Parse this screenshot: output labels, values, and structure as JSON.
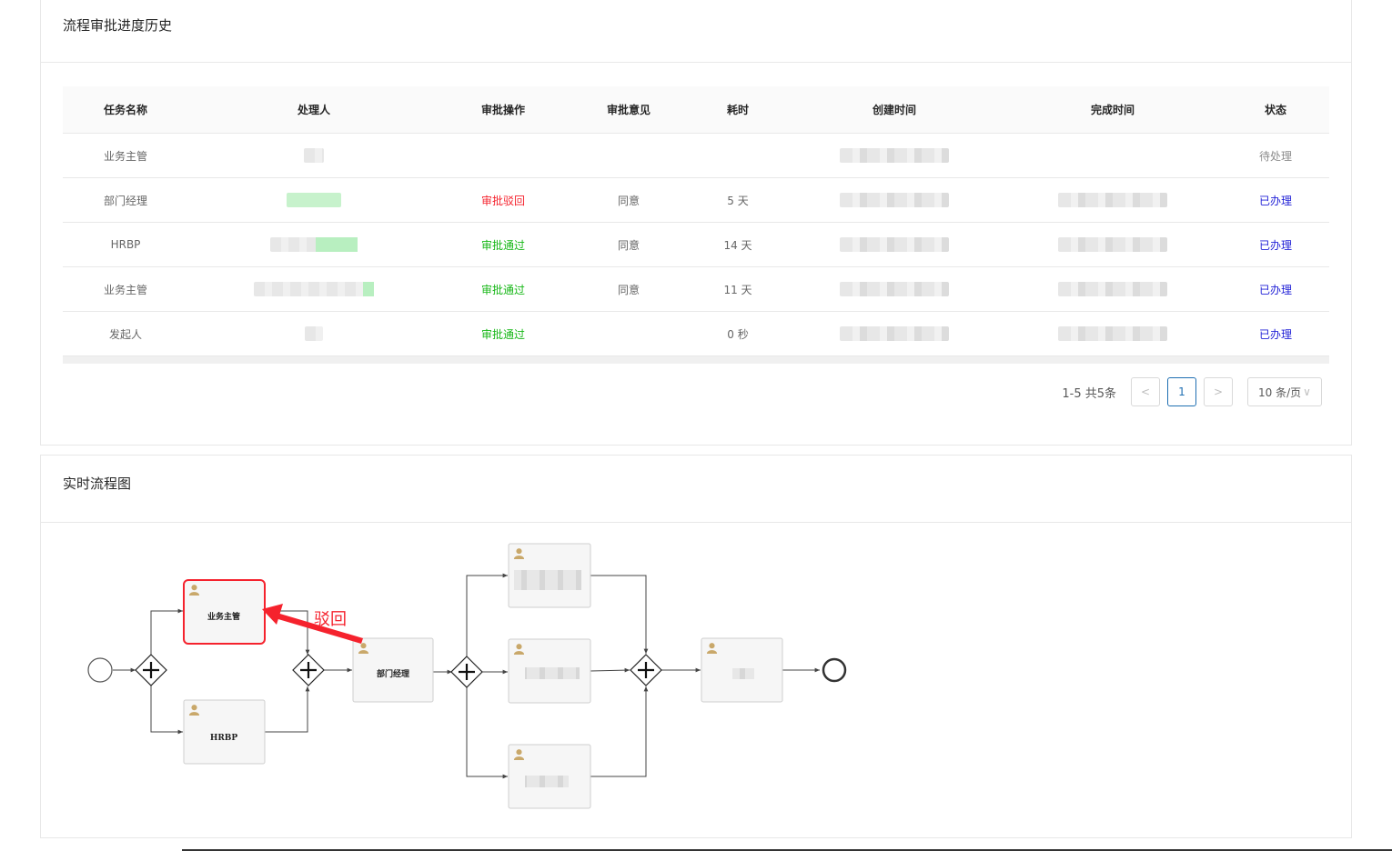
{
  "history": {
    "title": "流程审批进度历史",
    "columns": [
      "任务名称",
      "处理人",
      "审批操作",
      "审批意见",
      "耗时",
      "创建时间",
      "完成时间",
      "状态"
    ],
    "rows": [
      {
        "task": "业务主管",
        "operation": "",
        "opinion": "",
        "duration": "",
        "status": "待处理",
        "status_type": "pending",
        "op_type": ""
      },
      {
        "task": "部门经理",
        "operation": "审批驳回",
        "opinion": "同意",
        "duration": "5 天",
        "status": "已办理",
        "status_type": "done",
        "op_type": "reject"
      },
      {
        "task": "HRBP",
        "operation": "审批通过",
        "opinion": "同意",
        "duration": "14 天",
        "status": "已办理",
        "status_type": "done",
        "op_type": "pass"
      },
      {
        "task": "业务主管",
        "operation": "审批通过",
        "opinion": "同意",
        "duration": "11 天",
        "status": "已办理",
        "status_type": "done",
        "op_type": "pass"
      },
      {
        "task": "发起人",
        "operation": "审批通过",
        "opinion": "",
        "duration": "0 秒",
        "status": "已办理",
        "status_type": "done",
        "op_type": "pass"
      }
    ],
    "pagination": {
      "total_text": "1-5 共5条",
      "prev": "<",
      "current_page": "1",
      "next": ">",
      "page_size": "10 条/页"
    }
  },
  "diagram": {
    "title": "实时流程图",
    "nodes": {
      "supervisor": "业务主管",
      "hrbp": "HRBP",
      "dept_manager": "部门经理"
    },
    "reject_annotation": "驳回",
    "colors": {
      "highlight": "#f5222d",
      "user_icon": "#c9a86a"
    }
  }
}
